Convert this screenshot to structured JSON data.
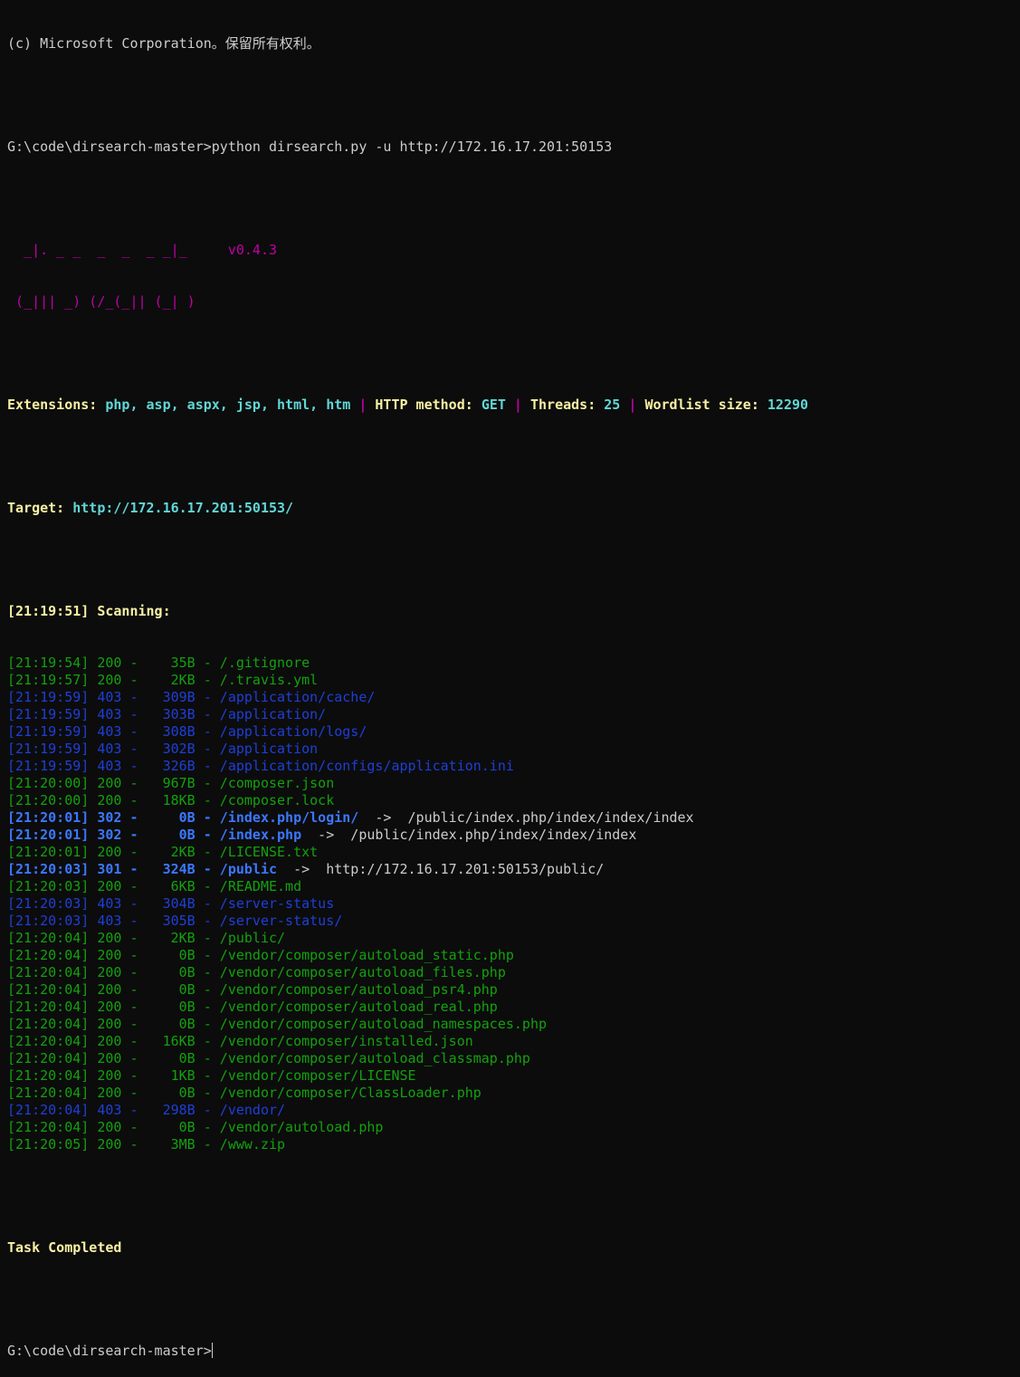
{
  "header": {
    "copyright": "(c) Microsoft Corporation。保留所有权利。",
    "prompt": "G:\\code\\dirsearch-master>",
    "command": "python dirsearch.py -u http://172.16.17.201:50153"
  },
  "banner": {
    "art_line1": "  _|. _ _  _  _  _ _|_",
    "art_line2": " (_||| _) (/_(_|| (_| )",
    "version": "v0.4.3"
  },
  "config": {
    "extensions_label": "Extensions: ",
    "extensions_value": "php, asp, aspx, jsp, html, htm",
    "sep": " | ",
    "method_label": "HTTP method: ",
    "method_value": "GET",
    "threads_label": "Threads: ",
    "threads_value": "25",
    "wordlist_label": "Wordlist size: ",
    "wordlist_value": "12290"
  },
  "target": {
    "label": "Target: ",
    "url": "http://172.16.17.201:50153/"
  },
  "scan": {
    "start": "[21:19:51] Scanning:",
    "results": [
      {
        "time": "[21:19:54]",
        "status": "200",
        "size": "35B",
        "path": "/.gitignore",
        "redirect": ""
      },
      {
        "time": "[21:19:57]",
        "status": "200",
        "size": "2KB",
        "path": "/.travis.yml",
        "redirect": ""
      },
      {
        "time": "[21:19:59]",
        "status": "403",
        "size": "309B",
        "path": "/application/cache/",
        "redirect": ""
      },
      {
        "time": "[21:19:59]",
        "status": "403",
        "size": "303B",
        "path": "/application/",
        "redirect": ""
      },
      {
        "time": "[21:19:59]",
        "status": "403",
        "size": "308B",
        "path": "/application/logs/",
        "redirect": ""
      },
      {
        "time": "[21:19:59]",
        "status": "403",
        "size": "302B",
        "path": "/application",
        "redirect": ""
      },
      {
        "time": "[21:19:59]",
        "status": "403",
        "size": "326B",
        "path": "/application/configs/application.ini",
        "redirect": ""
      },
      {
        "time": "[21:20:00]",
        "status": "200",
        "size": "967B",
        "path": "/composer.json",
        "redirect": ""
      },
      {
        "time": "[21:20:00]",
        "status": "200",
        "size": "18KB",
        "path": "/composer.lock",
        "redirect": ""
      },
      {
        "time": "[21:20:01]",
        "status": "302",
        "size": "0B",
        "path": "/index.php/login/",
        "redirect": "/public/index.php/index/index/index"
      },
      {
        "time": "[21:20:01]",
        "status": "302",
        "size": "0B",
        "path": "/index.php",
        "redirect": "/public/index.php/index/index/index"
      },
      {
        "time": "[21:20:01]",
        "status": "200",
        "size": "2KB",
        "path": "/LICENSE.txt",
        "redirect": ""
      },
      {
        "time": "[21:20:03]",
        "status": "301",
        "size": "324B",
        "path": "/public",
        "redirect": "http://172.16.17.201:50153/public/"
      },
      {
        "time": "[21:20:03]",
        "status": "200",
        "size": "6KB",
        "path": "/README.md",
        "redirect": ""
      },
      {
        "time": "[21:20:03]",
        "status": "403",
        "size": "304B",
        "path": "/server-status",
        "redirect": ""
      },
      {
        "time": "[21:20:03]",
        "status": "403",
        "size": "305B",
        "path": "/server-status/",
        "redirect": ""
      },
      {
        "time": "[21:20:04]",
        "status": "200",
        "size": "2KB",
        "path": "/public/",
        "redirect": ""
      },
      {
        "time": "[21:20:04]",
        "status": "200",
        "size": "0B",
        "path": "/vendor/composer/autoload_static.php",
        "redirect": ""
      },
      {
        "time": "[21:20:04]",
        "status": "200",
        "size": "0B",
        "path": "/vendor/composer/autoload_files.php",
        "redirect": ""
      },
      {
        "time": "[21:20:04]",
        "status": "200",
        "size": "0B",
        "path": "/vendor/composer/autoload_psr4.php",
        "redirect": ""
      },
      {
        "time": "[21:20:04]",
        "status": "200",
        "size": "0B",
        "path": "/vendor/composer/autoload_real.php",
        "redirect": ""
      },
      {
        "time": "[21:20:04]",
        "status": "200",
        "size": "0B",
        "path": "/vendor/composer/autoload_namespaces.php",
        "redirect": ""
      },
      {
        "time": "[21:20:04]",
        "status": "200",
        "size": "16KB",
        "path": "/vendor/composer/installed.json",
        "redirect": ""
      },
      {
        "time": "[21:20:04]",
        "status": "200",
        "size": "0B",
        "path": "/vendor/composer/autoload_classmap.php",
        "redirect": ""
      },
      {
        "time": "[21:20:04]",
        "status": "200",
        "size": "1KB",
        "path": "/vendor/composer/LICENSE",
        "redirect": ""
      },
      {
        "time": "[21:20:04]",
        "status": "200",
        "size": "0B",
        "path": "/vendor/composer/ClassLoader.php",
        "redirect": ""
      },
      {
        "time": "[21:20:04]",
        "status": "403",
        "size": "298B",
        "path": "/vendor/",
        "redirect": ""
      },
      {
        "time": "[21:20:04]",
        "status": "200",
        "size": "0B",
        "path": "/vendor/autoload.php",
        "redirect": ""
      },
      {
        "time": "[21:20:05]",
        "status": "200",
        "size": "3MB",
        "path": "/www.zip",
        "redirect": ""
      }
    ],
    "completed": "Task Completed"
  },
  "colors": {
    "background": "#0c0c0c",
    "status_200": "#13a10e",
    "status_403": "#1f3fd6",
    "status_3xx": "#3b78ff",
    "accent_magenta": "#c000a8",
    "label_yellow": "#f9f1a5",
    "value_cyan": "#61d6d6"
  }
}
